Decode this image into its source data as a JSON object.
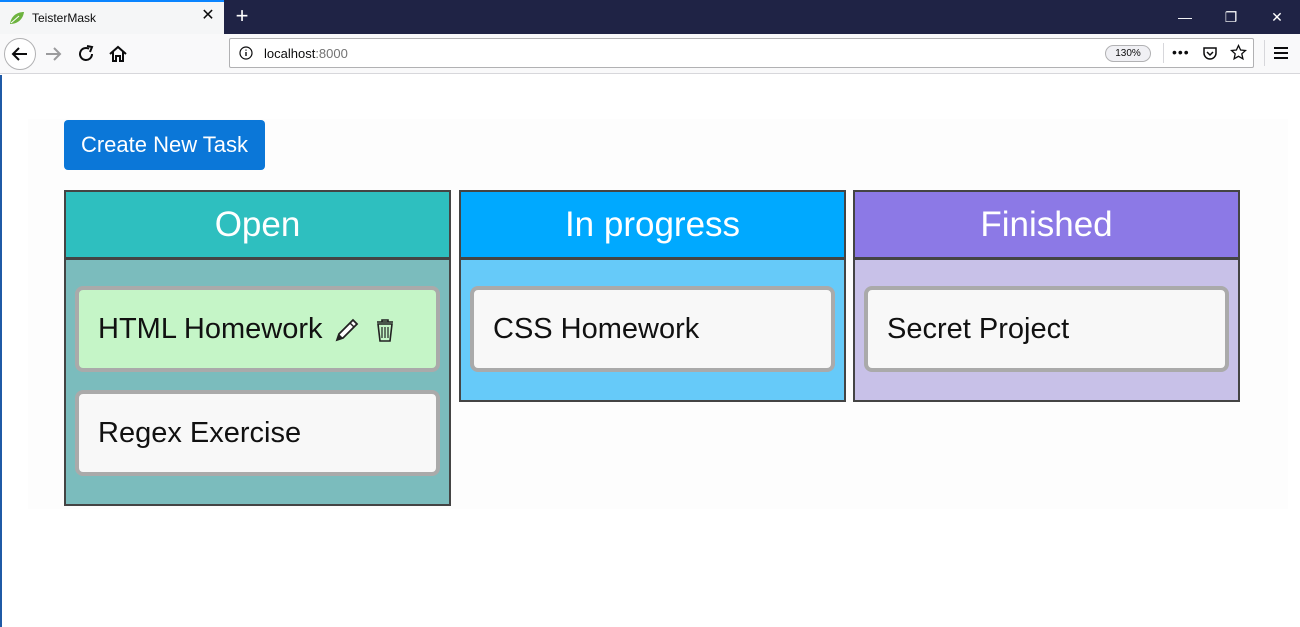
{
  "browser": {
    "tab_title": "TeisterMask",
    "tab_close": "✕",
    "new_tab": "+",
    "url_host": "localhost",
    "url_port": ":8000",
    "zoom": "130%",
    "more": "•••",
    "window_min": "—",
    "window_max": "❐",
    "window_close": "✕"
  },
  "page": {
    "create_button": "Create New Task",
    "columns": [
      {
        "title": "Open",
        "header_color": "#2ebfbf",
        "body_color": "#7bbcbd",
        "tasks": [
          {
            "name": "HTML Homework",
            "highlighted": true
          },
          {
            "name": "Regex Exercise"
          }
        ]
      },
      {
        "title": "In progress",
        "header_color": "#00a9ff",
        "body_color": "#66caf9",
        "tasks": [
          {
            "name": "CSS Homework"
          }
        ]
      },
      {
        "title": "Finished",
        "header_color": "#8c79e6",
        "body_color": "#c8c1e8",
        "tasks": [
          {
            "name": "Secret Project"
          }
        ]
      }
    ]
  },
  "icons": {
    "edit": "pencil-icon",
    "delete": "trash-icon"
  }
}
